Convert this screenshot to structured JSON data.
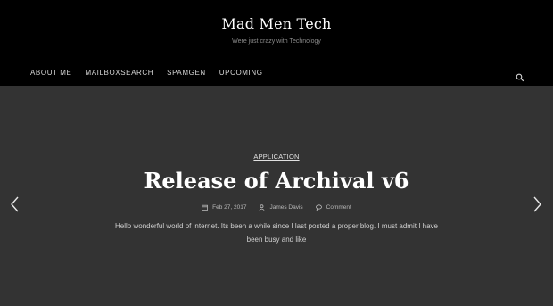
{
  "header": {
    "site_title": "Mad Men Tech",
    "tagline": "Were just crazy with Technology"
  },
  "nav": {
    "items": [
      {
        "label": "ABOUT ME"
      },
      {
        "label": "MAILBOXSEARCH"
      },
      {
        "label": "SPAMGEN"
      },
      {
        "label": "UPCOMING"
      }
    ],
    "search_icon": "search-icon"
  },
  "featured": {
    "category": "APPLICATION",
    "title": "Release of Archival v6",
    "date": "Feb 27, 2017",
    "author": "James Davis",
    "comment_label": "Comment",
    "excerpt": "Hello wonderful world of internet. Its been a while since I last posted a proper blog. I must admit I have been busy and like",
    "prev_icon": "chevron-left-icon",
    "next_icon": "chevron-right-icon"
  },
  "colors": {
    "header_bg": "#000000",
    "slider_bg": "#333333",
    "text": "#ffffff"
  }
}
